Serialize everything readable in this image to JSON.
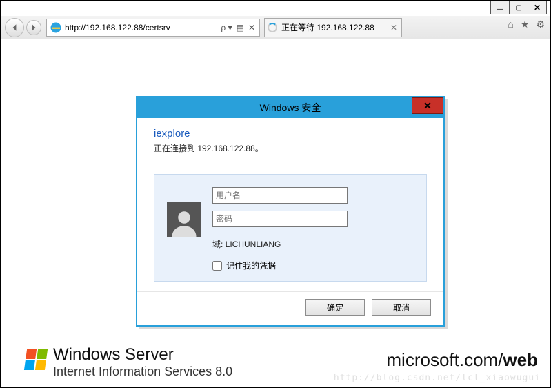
{
  "window_controls": {
    "min": "minimize",
    "max": "maximize",
    "close": "close"
  },
  "toolbar": {
    "url": "http://192.168.122.88/certsrv",
    "search_icon_sep": "ρ",
    "tab_label": "正在等待 192.168.122.88"
  },
  "dialog": {
    "title": "Windows 安全",
    "app": "iexplore",
    "connecting": "正在连接到 192.168.122.88。",
    "user_placeholder": "用户名",
    "pass_placeholder": "密码",
    "domain_label": "域: ",
    "domain_value": "LICHUNLIANG",
    "remember": "记住我的凭据",
    "ok": "确定",
    "cancel": "取消"
  },
  "branding": {
    "line1": "Windows Server",
    "line2": "Internet Information Services 8.0",
    "right_a": "microsoft.com/",
    "right_b": "web"
  },
  "watermark": "http://blog.csdn.net/lcl_xiaowugui"
}
